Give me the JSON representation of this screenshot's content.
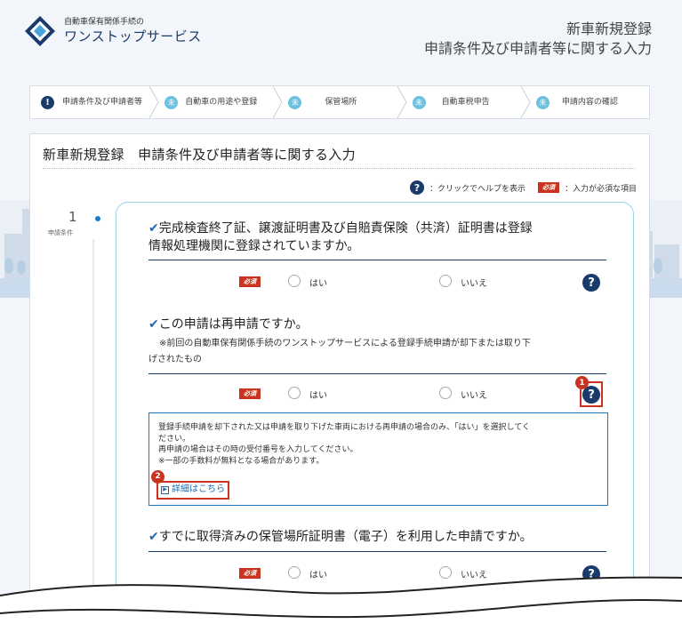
{
  "header": {
    "logo_small": "自動車保有関係手続の",
    "logo_big": "ワンストップサービス",
    "title_line1": "新車新規登録",
    "title_line2": "申請条件及び申請者等に関する入力"
  },
  "stepper": {
    "steps": [
      {
        "icon": "!",
        "label": "申請条件及び申請者等",
        "state": "current"
      },
      {
        "icon": "未",
        "label": "自動車の用途や登録",
        "state": "todo"
      },
      {
        "icon": "未",
        "label": "保管場所",
        "state": "todo"
      },
      {
        "icon": "未",
        "label": "自動車税申告",
        "state": "todo"
      },
      {
        "icon": "未",
        "label": "申請内容の確認",
        "state": "todo"
      }
    ]
  },
  "card": {
    "title": "新車新規登録　申請条件及び申請者等に関する入力",
    "legend_help_icon": "?",
    "legend_help_text": "：クリックでヘルプを表示",
    "legend_required_badge": "必須",
    "legend_required_text": "：入力が必須な項目",
    "side_number": "1",
    "side_label": "申請条件"
  },
  "questions": [
    {
      "check": "✔",
      "text_line1": "完成検査終了証、譲渡証明書及び自賠責保険（共済）証明書は登録",
      "text_line2": "情報処理機関に登録されていますか。",
      "required": "必須",
      "yes": "はい",
      "no": "いいえ",
      "help": "?"
    },
    {
      "check": "✔",
      "text": "この申請は再申請ですか。",
      "note_line1": "※前回の自動車保有関係手続のワンストップサービスによる登録手続申請が却下または取り下",
      "note_line2": "げされたもの",
      "required": "必須",
      "yes": "はい",
      "no": "いいえ",
      "help": "?"
    },
    {
      "check": "✔",
      "text": "すでに取得済みの保管場所証明書（電子）を利用した申請ですか。",
      "required": "必須",
      "yes": "はい",
      "no": "いいえ",
      "help": "?"
    }
  ],
  "help_box": {
    "line1": "登録手続申請を却下された又は申請を取り下げた車両における再申請の場合のみ、「はい」を選択してく",
    "line2": "ださい。",
    "line3": "再申請の場合はその時の受付番号を入力してください。",
    "line4": "※一部の手数料が無料となる場合があります。",
    "link": "詳細はこちら"
  },
  "annotations": {
    "badge1": "1",
    "badge2": "2"
  },
  "colors": {
    "navy": "#1a3a6a",
    "required_red": "#c9331f",
    "step_todo": "#6cc1df",
    "link_blue": "#1a6ab0"
  }
}
